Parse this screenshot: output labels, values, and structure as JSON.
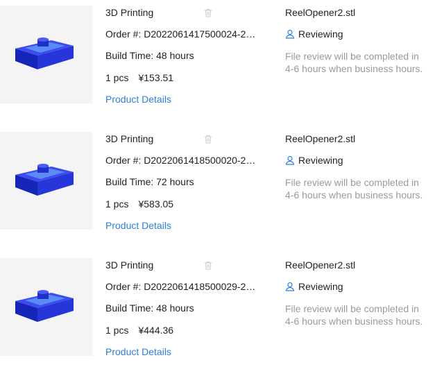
{
  "orders": [
    {
      "service": "3D Printing",
      "order_no": "Order #: D2022061417500024-2…",
      "build_time": "Build Time: 48 hours",
      "qty": "1 pcs",
      "price": "¥153.51",
      "details_link": "Product Details",
      "file_name": "ReelOpener2.stl",
      "status": "Reviewing",
      "note": "File review will be completed in 4-6 hours when business hours."
    },
    {
      "service": "3D Printing",
      "order_no": "Order #: D2022061418500020-2…",
      "build_time": "Build Time: 72 hours",
      "qty": "1 pcs",
      "price": "¥583.05",
      "details_link": "Product Details",
      "file_name": "ReelOpener2.stl",
      "status": "Reviewing",
      "note": "File review will be completed in 4-6 hours when business hours."
    },
    {
      "service": "3D Printing",
      "order_no": "Order #: D2022061418500029-2…",
      "build_time": "Build Time: 48 hours",
      "qty": "1 pcs",
      "price": "¥444.36",
      "details_link": "Product Details",
      "file_name": "ReelOpener2.stl",
      "status": "Reviewing",
      "note": "File review will be completed in 4-6 hours when business hours."
    }
  ],
  "colors": {
    "link": "#2f7fd7",
    "model": "#1a2bd6",
    "muted": "#9a9a9a"
  },
  "icons": [
    "trash-icon",
    "user-icon",
    "model-thumbnail"
  ]
}
